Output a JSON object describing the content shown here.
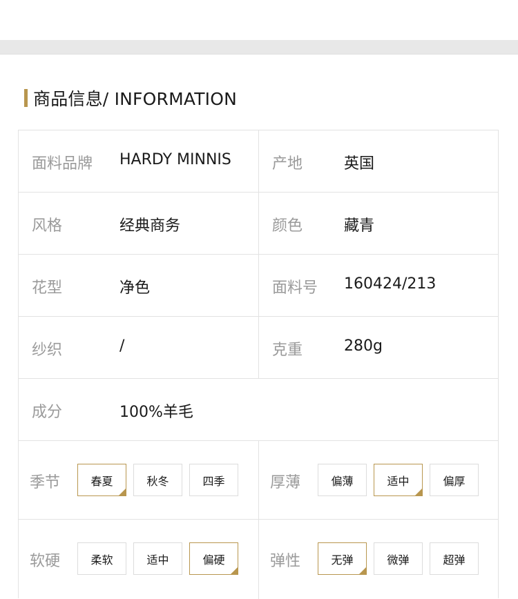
{
  "section": {
    "title": "商品信息/ INFORMATION"
  },
  "info_rows": [
    {
      "left": {
        "label": "面料品牌",
        "value": "HARDY MINNIS"
      },
      "right": {
        "label": "产地",
        "value": "英国"
      }
    },
    {
      "left": {
        "label": "风格",
        "value": "经典商务"
      },
      "right": {
        "label": "颜色",
        "value": "藏青"
      }
    },
    {
      "left": {
        "label": "花型",
        "value": "净色"
      },
      "right": {
        "label": "面料号",
        "value": "160424/213"
      }
    },
    {
      "left": {
        "label": "纱织",
        "value": "/"
      },
      "right": {
        "label": "克重",
        "value": "280g"
      }
    }
  ],
  "composition": {
    "label": "成分",
    "value": "100%羊毛"
  },
  "season": {
    "label": "季节",
    "options": [
      "春夏",
      "秋冬",
      "四季"
    ],
    "selected": "春夏"
  },
  "thickness": {
    "label": "厚薄",
    "options": [
      "偏薄",
      "适中",
      "偏厚"
    ],
    "selected": "适中"
  },
  "hardness": {
    "label": "软硬",
    "options": [
      "柔软",
      "适中",
      "偏硬"
    ],
    "selected": "偏硬"
  },
  "elasticity": {
    "label": "弹性",
    "options": [
      "无弹",
      "微弹",
      "超弹"
    ],
    "selected": "无弹"
  },
  "colors": {
    "accent": "#b8964e",
    "label_gray": "#9a9a9a",
    "border": "#e2e2e2",
    "band_gray": "#e8e8e8"
  }
}
